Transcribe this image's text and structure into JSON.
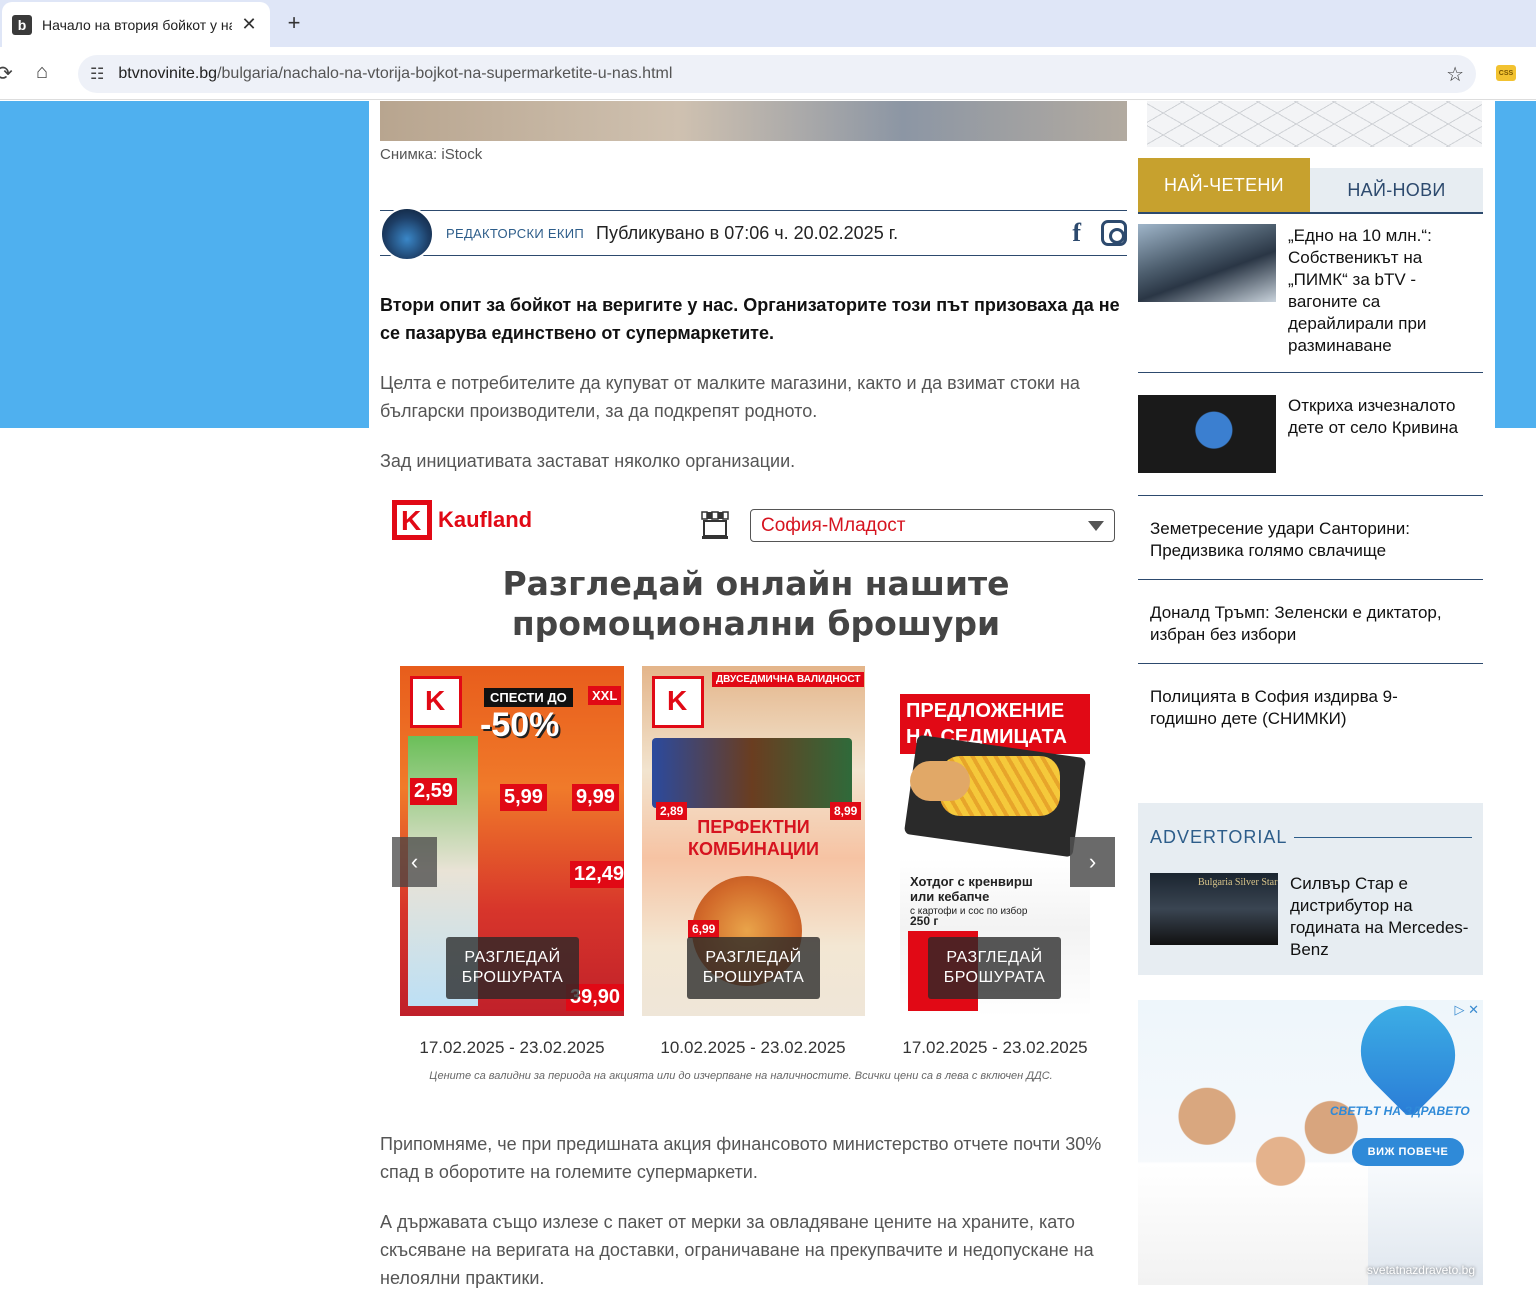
{
  "browser": {
    "tab_title": "Начало на втория бойкот у нас",
    "favicon": "b",
    "url_host": "btvnovinite.bg",
    "url_path": "/bulgaria/nachalo-na-vtorija-bojkot-na-supermarketite-u-nas.html",
    "extension_label": "CSS"
  },
  "article": {
    "photo_caption": "Снимка: iStock",
    "author": "РЕДАКТОРСКИ ЕКИП",
    "published": "Публикувано в 07:06 ч. 20.02.2025 г.",
    "lead": "Втори опит за бойкот на веригите у нас. Организаторите този път призоваха да не се пазарува единствено от супермаркетите.",
    "paragraphs": [
      "Целта е потребителите да купуват от малките магазини, както и да взимат стоки на български производители, за да подкрепят родното.",
      "Зад инициативата застават няколко организации.",
      "Припомняме, че при предишната акция финансовото министерство отчете почти 30% спад в оборотите на големите супермаркети.",
      "А държавата също излезе с пакет от мерки за овладяване цените на храните, като скъсяване на веригата на доставки, ограничаване на прекупвачите и недопускане на нелоялни практики."
    ]
  },
  "kaufland": {
    "brand": "Kaufland",
    "store": "София-Младост",
    "heading_line1": "Разгледай онлайн нашите",
    "heading_line2": "промоционални брошури",
    "view_label_1": "РАЗГЛЕДАЙ",
    "view_label_2": "БРОШУРАТА",
    "disclaimer": "Цените са валидни за периода на акцията или до изчерпване на наличностите. Всички цени са в лева с включен ДДС.",
    "brochures": [
      {
        "dates": "17.02.2025 - 23.02.2025",
        "headline": "-50%",
        "tag": "СПЕСТИ ДО",
        "badge": "XXL",
        "price1": "2,59",
        "price2": "5,99",
        "price3": "9,99",
        "price4": "12,49",
        "price5": "39,90"
      },
      {
        "dates": "10.02.2025 - 23.02.2025",
        "banner": "ДВУСЕДМИЧНА ВАЛИДНОСТ",
        "mid": "ПЕРФЕКТНИ КОМБИНАЦИИ",
        "price1": "2,89",
        "price2": "8,99",
        "price3": "6,99"
      },
      {
        "dates": "17.02.2025 - 23.02.2025",
        "banner": "ПРЕДЛОЖЕНИЕ НА СЕДМИЦАТА",
        "desc_line1": "Хотдог с кренвирш",
        "desc_line2": "или кебапче",
        "desc_line3": "с картофи и сос по избор",
        "weight": "250 г"
      }
    ]
  },
  "sidebar": {
    "tab_popular": "НАЙ-ЧЕТЕНИ",
    "tab_latest": "НАЙ-НОВИ",
    "news": [
      {
        "title": "„Едно на 10 млн.“: Собственикът на „ПИМК“ за bTV - вагоните са дерайлирали при разминаване"
      },
      {
        "title": "Откриха изчезналото дете от село Кривина"
      },
      {
        "title": "Земетресение удари Санторини: Предизвика голямо свлачище"
      },
      {
        "title": "Доналд Тръмп: Зеленски е диктатор, избран без избори"
      },
      {
        "title": "Полицията в София издирва 9-годишно дете (СНИМКИ)"
      }
    ],
    "advertorial_label": "ADVERTORIAL",
    "advertorial_thumb_text": "Bulgaria Silver Star",
    "advertorial_title": "Силвър Стар е дистрибутор на годината на Mercedes-Benz",
    "ad": {
      "brand": "СВЕТЪТ НА ЗДРАВЕТО",
      "cta": "ВИЖ ПОВЕЧЕ",
      "site": "svetatnazdraveto.bg"
    }
  }
}
